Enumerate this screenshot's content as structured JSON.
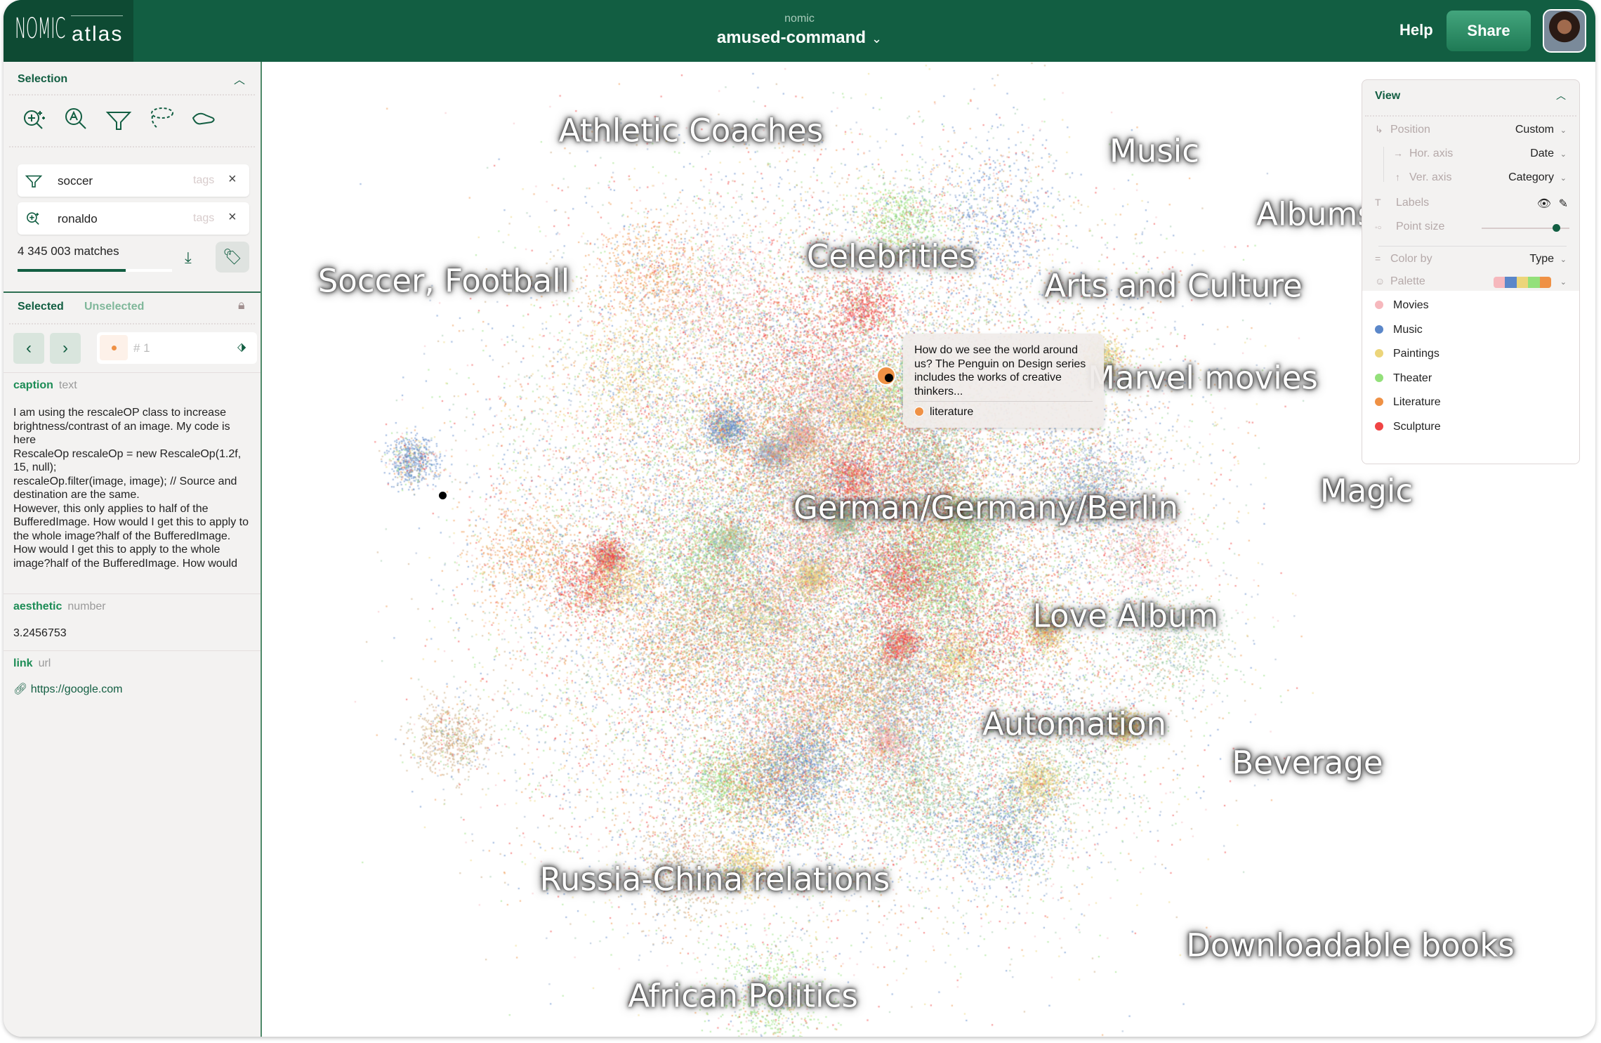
{
  "header": {
    "logo_text": "NOMIC atlas",
    "org": "nomic",
    "project": "amused-command",
    "help_label": "Help",
    "share_label": "Share"
  },
  "selection": {
    "title": "Selection",
    "tools": [
      "semantic-search-icon",
      "lexical-search-icon",
      "filter-icon",
      "lasso-icon",
      "hand-icon"
    ],
    "filters": [
      {
        "icon": "filter-icon",
        "value": "soccer",
        "field": "tags"
      },
      {
        "icon": "semantic-search-icon",
        "value": "ronaldo",
        "field": "tags"
      }
    ],
    "matches": "4 345 003 matches",
    "progress": 0.7
  },
  "tabs": {
    "selected": "Selected",
    "unselected": "Unselected"
  },
  "record": {
    "index": "# 1",
    "color": "#ef9145"
  },
  "fields": [
    {
      "name": "caption",
      "type": "text",
      "value": "I am using the rescaleOP class to increase brightness/contrast of an image. My code is here\nRescaleOp rescaleOp = new RescaleOp(1.2f, 15, null);\nrescaleOp.filter(image, image); // Source and destination are the same.\nHowever, this only applies to half of the BufferedImage. How would I get this to apply to the whole image?half of the BufferedImage. How would I get this to apply to the whole image?half of the BufferedImage. How would"
    },
    {
      "name": "aesthetic",
      "type": "number",
      "value": "3.2456753"
    },
    {
      "name": "link",
      "type": "url",
      "value": "https://google.com"
    }
  ],
  "map": {
    "labels": [
      "Athletic Coaches",
      "Music",
      "Albums",
      "Celebrities",
      "Soccer, Football",
      "Arts and Culture",
      "Marvel movies",
      "Magic",
      "German/Germany/Berlin",
      "Love Album",
      "Automation",
      "Beverage",
      "Russia-China relations",
      "Downloadable books",
      "African Politics"
    ],
    "tooltip": {
      "text": "How do we see the world around us? The Penguin on Design series includes the works of creative thinkers...",
      "category": "literature"
    }
  },
  "view": {
    "title": "View",
    "position": {
      "label": "Position",
      "value": "Custom"
    },
    "hor_axis": {
      "label": "Hor. axis",
      "value": "Date"
    },
    "ver_axis": {
      "label": "Ver. axis",
      "value": "Category"
    },
    "labels_label": "Labels",
    "point_size": {
      "label": "Point size",
      "value": 0.85
    },
    "color_by": {
      "label": "Color by",
      "value": "Type"
    },
    "palette_label": "Palette",
    "legend": [
      {
        "name": "Movies",
        "color": "#f6b8bd"
      },
      {
        "name": "Music",
        "color": "#5b87c9"
      },
      {
        "name": "Paintings",
        "color": "#ecd57a"
      },
      {
        "name": "Theater",
        "color": "#93e07a"
      },
      {
        "name": "Literature",
        "color": "#ef9145"
      },
      {
        "name": "Sculpture",
        "color": "#f04444"
      }
    ]
  }
}
